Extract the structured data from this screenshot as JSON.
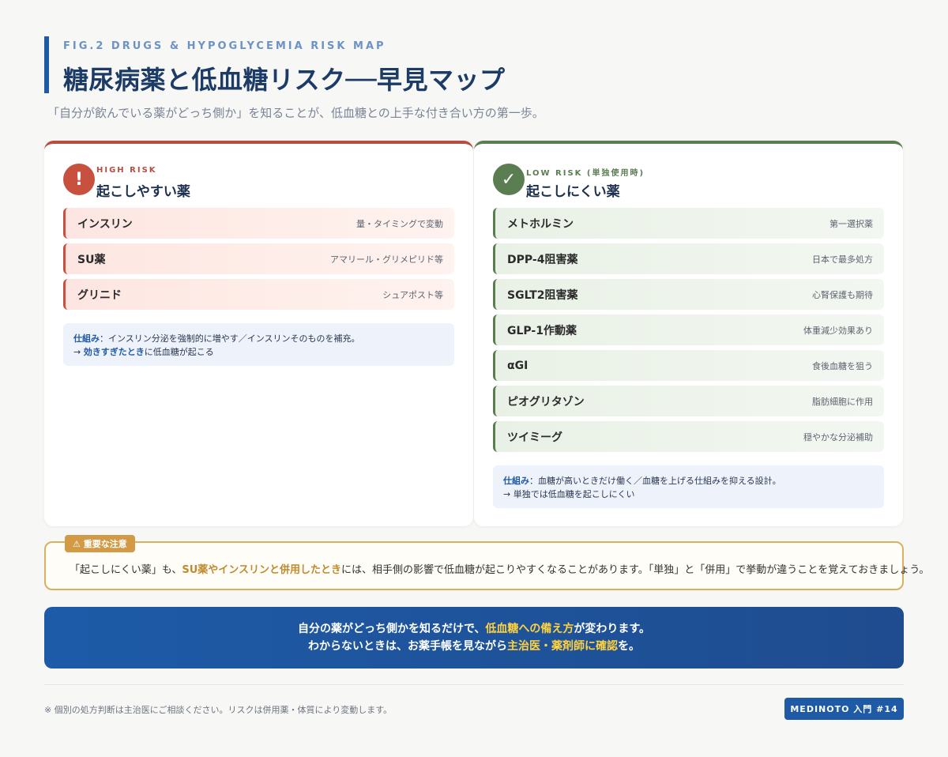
{
  "header": {
    "eyebrow": "FIG.2 DRUGS & HYPOGLYCEMIA RISK MAP",
    "title": "糖尿病薬と低血糖リスク──早見マップ",
    "subtitle": "「自分が飲んでいる薬がどっち側か」を知ることが、低血糖との上手な付き合い方の第一歩。"
  },
  "high_risk": {
    "icon": "!",
    "label": "HIGH RISK",
    "title": "起こしやすい薬",
    "drugs": [
      {
        "name": "インスリン",
        "note": "量・タイミングで変動"
      },
      {
        "name": "SU薬",
        "note": "アマリール・グリメピリド等"
      },
      {
        "name": "グリニド",
        "note": "シュアポスト等"
      }
    ],
    "mechanism_key": "仕組み",
    "mechanism_line1": "：インスリン分泌を強制的に増やす／インスリンそのものを補充。",
    "mechanism_arrow": "→ ",
    "mechanism_em": "効きすぎたとき",
    "mechanism_line2": "に低血糖が起こる"
  },
  "low_risk": {
    "icon": "✓",
    "label": "LOW RISK (単独使用時)",
    "title": "起こしにくい薬",
    "drugs": [
      {
        "name": "メトホルミン",
        "note": "第一選択薬"
      },
      {
        "name": "DPP-4阻害薬",
        "note": "日本で最多処方"
      },
      {
        "name": "SGLT2阻害薬",
        "note": "心腎保護も期待"
      },
      {
        "name": "GLP-1作動薬",
        "note": "体重減少効果あり"
      },
      {
        "name": "αGI",
        "note": "食後血糖を狙う"
      },
      {
        "name": "ピオグリタゾン",
        "note": "脂肪細胞に作用"
      },
      {
        "name": "ツイミーグ",
        "note": "穏やかな分泌補助"
      }
    ],
    "mechanism_key": "仕組み",
    "mechanism_line1": "：血糖が高いときだけ働く／血糖を上げる仕組みを抑える設計。",
    "mechanism_line2": "→ 単独では低血糖を起こしにくい"
  },
  "notice": {
    "tag": "⚠ 重要な注意",
    "text_before": "「起こしにくい薬」も、",
    "text_em": "SU薬やインスリンと併用したとき",
    "text_after": "には、相手側の影響で低血糖が起こりやすくなることがあります。「単独」と「併用」で挙動が違うことを覚えておきましょう。"
  },
  "banner": {
    "line1_before": "自分の薬がどっち側かを知るだけで、",
    "line1_em": "低血糖への備え方",
    "line1_after": "が変わります。",
    "line2_before": "わからないときは、お薬手帳を見ながら",
    "line2_em": "主治医・薬剤師に確認",
    "line2_after": "を。"
  },
  "footer": {
    "note": "※ 個別の処方判断は主治医にご相談ください。リスクは併用薬・体質により変動します。",
    "badge": "MEDINOTO 入門 #14"
  },
  "colors": {
    "high": "#c8503f",
    "low": "#5a7d52",
    "primary": "#1f5aa6",
    "highlight": "#ffd23f",
    "notice": "#d29a45"
  }
}
